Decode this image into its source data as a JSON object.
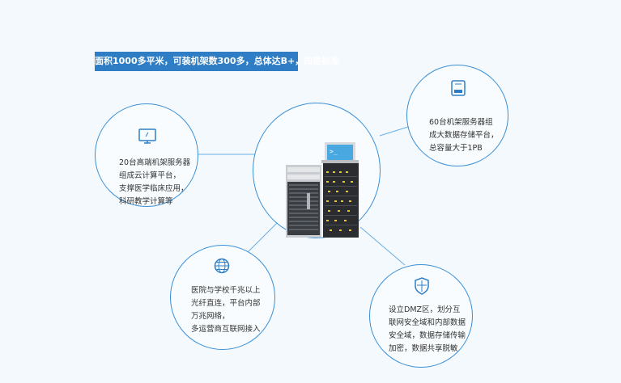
{
  "banner": {
    "text": "面积1000多平米，可装机架数300多，总体达B+，四星标准"
  },
  "features": {
    "storage": {
      "icon": "storage-drive-icon",
      "text": "60台机架服务器组\n成大数据存储平台，\n总容量大于1PB"
    },
    "cloud": {
      "icon": "monitor-icon",
      "text": "20台高端机架服务器\n组成云计算平台，\n支撑医学临床应用，\n科研教学计算等"
    },
    "network": {
      "icon": "globe-icon",
      "text": "医院与学校千兆以上\n光纤直连，平台内部\n万兆网络，\n多运营商互联网接入"
    },
    "security": {
      "icon": "shield-icon",
      "text": "设立DMZ区，划分互\n联网安全域和内部数据\n安全域，数据存储传输\n加密，数据共享脱敏"
    }
  },
  "colors": {
    "accent": "#2f7ec5",
    "circle_border": "#3a8fd6",
    "background": "#f3f9fd"
  }
}
